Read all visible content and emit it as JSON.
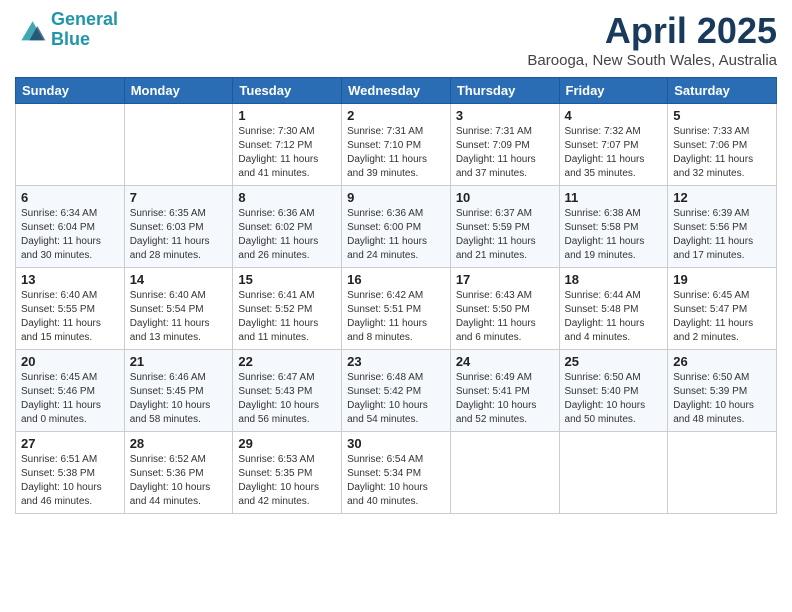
{
  "header": {
    "logo_line1": "General",
    "logo_line2": "Blue",
    "month": "April 2025",
    "location": "Barooga, New South Wales, Australia"
  },
  "weekdays": [
    "Sunday",
    "Monday",
    "Tuesday",
    "Wednesday",
    "Thursday",
    "Friday",
    "Saturday"
  ],
  "weeks": [
    [
      {
        "day": "",
        "info": ""
      },
      {
        "day": "",
        "info": ""
      },
      {
        "day": "1",
        "info": "Sunrise: 7:30 AM\nSunset: 7:12 PM\nDaylight: 11 hours and 41 minutes."
      },
      {
        "day": "2",
        "info": "Sunrise: 7:31 AM\nSunset: 7:10 PM\nDaylight: 11 hours and 39 minutes."
      },
      {
        "day": "3",
        "info": "Sunrise: 7:31 AM\nSunset: 7:09 PM\nDaylight: 11 hours and 37 minutes."
      },
      {
        "day": "4",
        "info": "Sunrise: 7:32 AM\nSunset: 7:07 PM\nDaylight: 11 hours and 35 minutes."
      },
      {
        "day": "5",
        "info": "Sunrise: 7:33 AM\nSunset: 7:06 PM\nDaylight: 11 hours and 32 minutes."
      }
    ],
    [
      {
        "day": "6",
        "info": "Sunrise: 6:34 AM\nSunset: 6:04 PM\nDaylight: 11 hours and 30 minutes."
      },
      {
        "day": "7",
        "info": "Sunrise: 6:35 AM\nSunset: 6:03 PM\nDaylight: 11 hours and 28 minutes."
      },
      {
        "day": "8",
        "info": "Sunrise: 6:36 AM\nSunset: 6:02 PM\nDaylight: 11 hours and 26 minutes."
      },
      {
        "day": "9",
        "info": "Sunrise: 6:36 AM\nSunset: 6:00 PM\nDaylight: 11 hours and 24 minutes."
      },
      {
        "day": "10",
        "info": "Sunrise: 6:37 AM\nSunset: 5:59 PM\nDaylight: 11 hours and 21 minutes."
      },
      {
        "day": "11",
        "info": "Sunrise: 6:38 AM\nSunset: 5:58 PM\nDaylight: 11 hours and 19 minutes."
      },
      {
        "day": "12",
        "info": "Sunrise: 6:39 AM\nSunset: 5:56 PM\nDaylight: 11 hours and 17 minutes."
      }
    ],
    [
      {
        "day": "13",
        "info": "Sunrise: 6:40 AM\nSunset: 5:55 PM\nDaylight: 11 hours and 15 minutes."
      },
      {
        "day": "14",
        "info": "Sunrise: 6:40 AM\nSunset: 5:54 PM\nDaylight: 11 hours and 13 minutes."
      },
      {
        "day": "15",
        "info": "Sunrise: 6:41 AM\nSunset: 5:52 PM\nDaylight: 11 hours and 11 minutes."
      },
      {
        "day": "16",
        "info": "Sunrise: 6:42 AM\nSunset: 5:51 PM\nDaylight: 11 hours and 8 minutes."
      },
      {
        "day": "17",
        "info": "Sunrise: 6:43 AM\nSunset: 5:50 PM\nDaylight: 11 hours and 6 minutes."
      },
      {
        "day": "18",
        "info": "Sunrise: 6:44 AM\nSunset: 5:48 PM\nDaylight: 11 hours and 4 minutes."
      },
      {
        "day": "19",
        "info": "Sunrise: 6:45 AM\nSunset: 5:47 PM\nDaylight: 11 hours and 2 minutes."
      }
    ],
    [
      {
        "day": "20",
        "info": "Sunrise: 6:45 AM\nSunset: 5:46 PM\nDaylight: 11 hours and 0 minutes."
      },
      {
        "day": "21",
        "info": "Sunrise: 6:46 AM\nSunset: 5:45 PM\nDaylight: 10 hours and 58 minutes."
      },
      {
        "day": "22",
        "info": "Sunrise: 6:47 AM\nSunset: 5:43 PM\nDaylight: 10 hours and 56 minutes."
      },
      {
        "day": "23",
        "info": "Sunrise: 6:48 AM\nSunset: 5:42 PM\nDaylight: 10 hours and 54 minutes."
      },
      {
        "day": "24",
        "info": "Sunrise: 6:49 AM\nSunset: 5:41 PM\nDaylight: 10 hours and 52 minutes."
      },
      {
        "day": "25",
        "info": "Sunrise: 6:50 AM\nSunset: 5:40 PM\nDaylight: 10 hours and 50 minutes."
      },
      {
        "day": "26",
        "info": "Sunrise: 6:50 AM\nSunset: 5:39 PM\nDaylight: 10 hours and 48 minutes."
      }
    ],
    [
      {
        "day": "27",
        "info": "Sunrise: 6:51 AM\nSunset: 5:38 PM\nDaylight: 10 hours and 46 minutes."
      },
      {
        "day": "28",
        "info": "Sunrise: 6:52 AM\nSunset: 5:36 PM\nDaylight: 10 hours and 44 minutes."
      },
      {
        "day": "29",
        "info": "Sunrise: 6:53 AM\nSunset: 5:35 PM\nDaylight: 10 hours and 42 minutes."
      },
      {
        "day": "30",
        "info": "Sunrise: 6:54 AM\nSunset: 5:34 PM\nDaylight: 10 hours and 40 minutes."
      },
      {
        "day": "",
        "info": ""
      },
      {
        "day": "",
        "info": ""
      },
      {
        "day": "",
        "info": ""
      }
    ]
  ]
}
